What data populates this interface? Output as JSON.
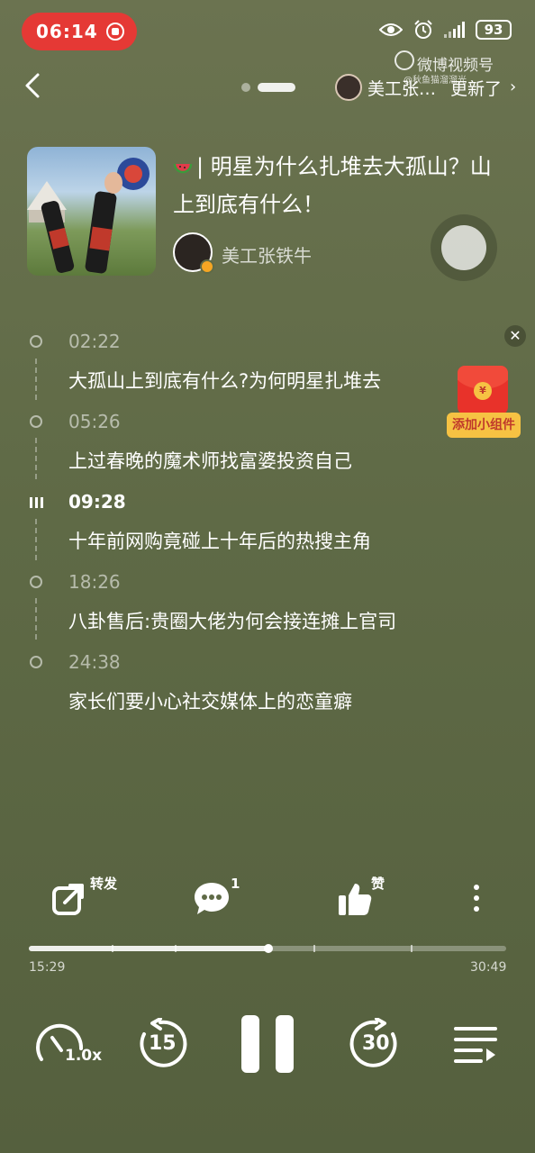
{
  "status_bar": {
    "time": "06:14",
    "battery": "93"
  },
  "watermark": {
    "brand": "微博视频号",
    "handle": "@秋鱼猫溜溜光"
  },
  "header": {
    "author_label": "美工张…",
    "updated_label": "更新了"
  },
  "episode": {
    "title": "| 明星为什么扎堆去大孤山？山上到底有什么！",
    "creator": "美工张铁牛"
  },
  "chapters": [
    {
      "time": "02:22",
      "title": "大孤山上到底有什么?为何明星扎堆去"
    },
    {
      "time": "05:26",
      "title": "上过春晚的魔术师找富婆投资自己"
    },
    {
      "time": "09:28",
      "title": "十年前网购竟碰上十年后的热搜主角",
      "playing": true
    },
    {
      "time": "18:26",
      "title": "八卦售后:贵圈大佬为何会接连摊上官司"
    },
    {
      "time": "24:38",
      "title": "家长们要小心社交媒体上的恋童癖"
    }
  ],
  "widget": {
    "label": "添加小组件"
  },
  "actions": {
    "share": "转发",
    "comment_count": "1",
    "like": "赞"
  },
  "player": {
    "elapsed": "15:29",
    "total": "30:49",
    "progress": 0.502,
    "speed": "1.0x",
    "rewind_seconds": "15",
    "forward_seconds": "30"
  },
  "colors": {
    "background": "#5f6a46",
    "record_pill": "#e53935",
    "widget_red": "#e8322a",
    "widget_gold": "#f6c243"
  }
}
